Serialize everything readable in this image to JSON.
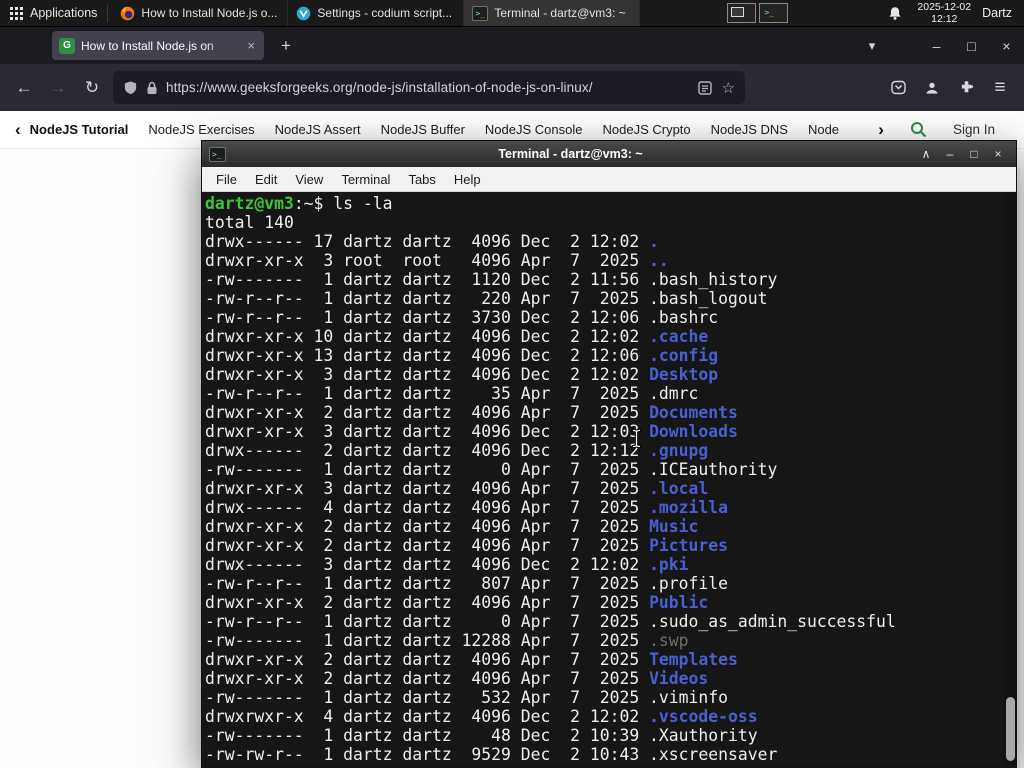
{
  "panel": {
    "applications_label": "Applications",
    "tasks": [
      {
        "label": "How to Install Node.js o...",
        "icon": "firefox-icon"
      },
      {
        "label": "Settings - codium script...",
        "icon": "codium-icon"
      },
      {
        "label": "Terminal - dartz@vm3: ~",
        "icon": "terminal-icon"
      }
    ],
    "clock": {
      "date": "2025-12-02",
      "time": "12:12"
    },
    "user": "Dartz"
  },
  "browser": {
    "tab": {
      "title": "How to Install Node.js on"
    },
    "nav": {
      "url": "https://www.geeksforgeeks.org/node-js/installation-of-node-js-on-linux/"
    },
    "site_nav": {
      "items": [
        "NodeJS Tutorial",
        "NodeJS Exercises",
        "NodeJS Assert",
        "NodeJS Buffer",
        "NodeJS Console",
        "NodeJS Crypto",
        "NodeJS DNS",
        "Node"
      ],
      "sign_in": "Sign In"
    }
  },
  "terminal": {
    "title": "Terminal - dartz@vm3: ~",
    "menu": [
      "File",
      "Edit",
      "View",
      "Terminal",
      "Tabs",
      "Help"
    ],
    "lines": [
      [
        {
          "c": "g",
          "t": "dartz@vm3"
        },
        {
          "t": ":~$ ls -la"
        }
      ],
      [
        {
          "t": "total 140"
        }
      ],
      [
        {
          "t": "drwx------ 17 dartz dartz  4096 Dec  2 12:02 "
        },
        {
          "c": "d",
          "t": "."
        }
      ],
      [
        {
          "t": "drwxr-xr-x  3 root  root   4096 Apr  7  2025 "
        },
        {
          "c": "d",
          "t": ".."
        }
      ],
      [
        {
          "t": "-rw-------  1 dartz dartz  1120 Dec  2 11:56 .bash_history"
        }
      ],
      [
        {
          "t": "-rw-r--r--  1 dartz dartz   220 Apr  7  2025 .bash_logout"
        }
      ],
      [
        {
          "t": "-rw-r--r--  1 dartz dartz  3730 Dec  2 12:06 .bashrc"
        }
      ],
      [
        {
          "t": "drwxr-xr-x 10 dartz dartz  4096 Dec  2 12:02 "
        },
        {
          "c": "d",
          "t": ".cache"
        }
      ],
      [
        {
          "t": "drwxr-xr-x 13 dartz dartz  4096 Dec  2 12:06 "
        },
        {
          "c": "d",
          "t": ".config"
        }
      ],
      [
        {
          "t": "drwxr-xr-x  3 dartz dartz  4096 Dec  2 12:02 "
        },
        {
          "c": "d",
          "t": "Desktop"
        }
      ],
      [
        {
          "t": "-rw-r--r--  1 dartz dartz    35 Apr  7  2025 .dmrc"
        }
      ],
      [
        {
          "t": "drwxr-xr-x  2 dartz dartz  4096 Apr  7  2025 "
        },
        {
          "c": "d",
          "t": "Documents"
        }
      ],
      [
        {
          "t": "drwxr-xr-x  3 dartz dartz  4096 Dec  2 12:03 "
        },
        {
          "c": "d",
          "t": "Downloads"
        }
      ],
      [
        {
          "t": "drwx------  2 dartz dartz  4096 Dec  2 12:12 "
        },
        {
          "c": "d",
          "t": ".gnupg"
        }
      ],
      [
        {
          "t": "-rw-------  1 dartz dartz     0 Apr  7  2025 .ICEauthority"
        }
      ],
      [
        {
          "t": "drwxr-xr-x  3 dartz dartz  4096 Apr  7  2025 "
        },
        {
          "c": "d",
          "t": ".local"
        }
      ],
      [
        {
          "t": "drwx------  4 dartz dartz  4096 Apr  7  2025 "
        },
        {
          "c": "d",
          "t": ".mozilla"
        }
      ],
      [
        {
          "t": "drwxr-xr-x  2 dartz dartz  4096 Apr  7  2025 "
        },
        {
          "c": "d",
          "t": "Music"
        }
      ],
      [
        {
          "t": "drwxr-xr-x  2 dartz dartz  4096 Apr  7  2025 "
        },
        {
          "c": "d",
          "t": "Pictures"
        }
      ],
      [
        {
          "t": "drwx------  3 dartz dartz  4096 Dec  2 12:02 "
        },
        {
          "c": "d",
          "t": ".pki"
        }
      ],
      [
        {
          "t": "-rw-r--r--  1 dartz dartz   807 Apr  7  2025 .profile"
        }
      ],
      [
        {
          "t": "drwxr-xr-x  2 dartz dartz  4096 Apr  7  2025 "
        },
        {
          "c": "d",
          "t": "Public"
        }
      ],
      [
        {
          "t": "-rw-r--r--  1 dartz dartz     0 Apr  7  2025 .sudo_as_admin_successful"
        }
      ],
      [
        {
          "t": "-rw-------  1 dartz dartz 12288 Apr  7  2025 "
        },
        {
          "c": "m",
          "t": ".swp"
        }
      ],
      [
        {
          "t": "drwxr-xr-x  2 dartz dartz  4096 Apr  7  2025 "
        },
        {
          "c": "d",
          "t": "Templates"
        }
      ],
      [
        {
          "t": "drwxr-xr-x  2 dartz dartz  4096 Apr  7  2025 "
        },
        {
          "c": "d",
          "t": "Videos"
        }
      ],
      [
        {
          "t": "-rw-------  1 dartz dartz   532 Apr  7  2025 .viminfo"
        }
      ],
      [
        {
          "t": "drwxrwxr-x  4 dartz dartz  4096 Dec  2 12:02 "
        },
        {
          "c": "d",
          "t": ".vscode-oss"
        }
      ],
      [
        {
          "t": "-rw-------  1 dartz dartz    48 Dec  2 10:39 .Xauthority"
        }
      ],
      [
        {
          "t": "-rw-rw-r--  1 dartz dartz  9529 Dec  2 10:43 .xscreensaver"
        }
      ]
    ]
  },
  "icons": {
    "back": "←",
    "forward": "→",
    "reload": "↻",
    "new_tab": "+",
    "tab_list": "▾",
    "minimize": "–",
    "maximize": "□",
    "close": "×",
    "shade": "∧",
    "menu": "≡",
    "bookmark_star": "☆",
    "chevron_left": "‹",
    "chevron_right": "›",
    "terminal_glyph": ">_",
    "gfg_logo": "G"
  },
  "colors": {
    "gfg_green": "#2f8d46",
    "terminal_prompt_green": "#3cc43c",
    "terminal_dir_blue": "#4a5fd0",
    "terminal_dim": "#6e6e6e",
    "terminal_bg": "#161616",
    "panel_bg": "#191919",
    "firefox_toolbar": "#2b2a33"
  }
}
